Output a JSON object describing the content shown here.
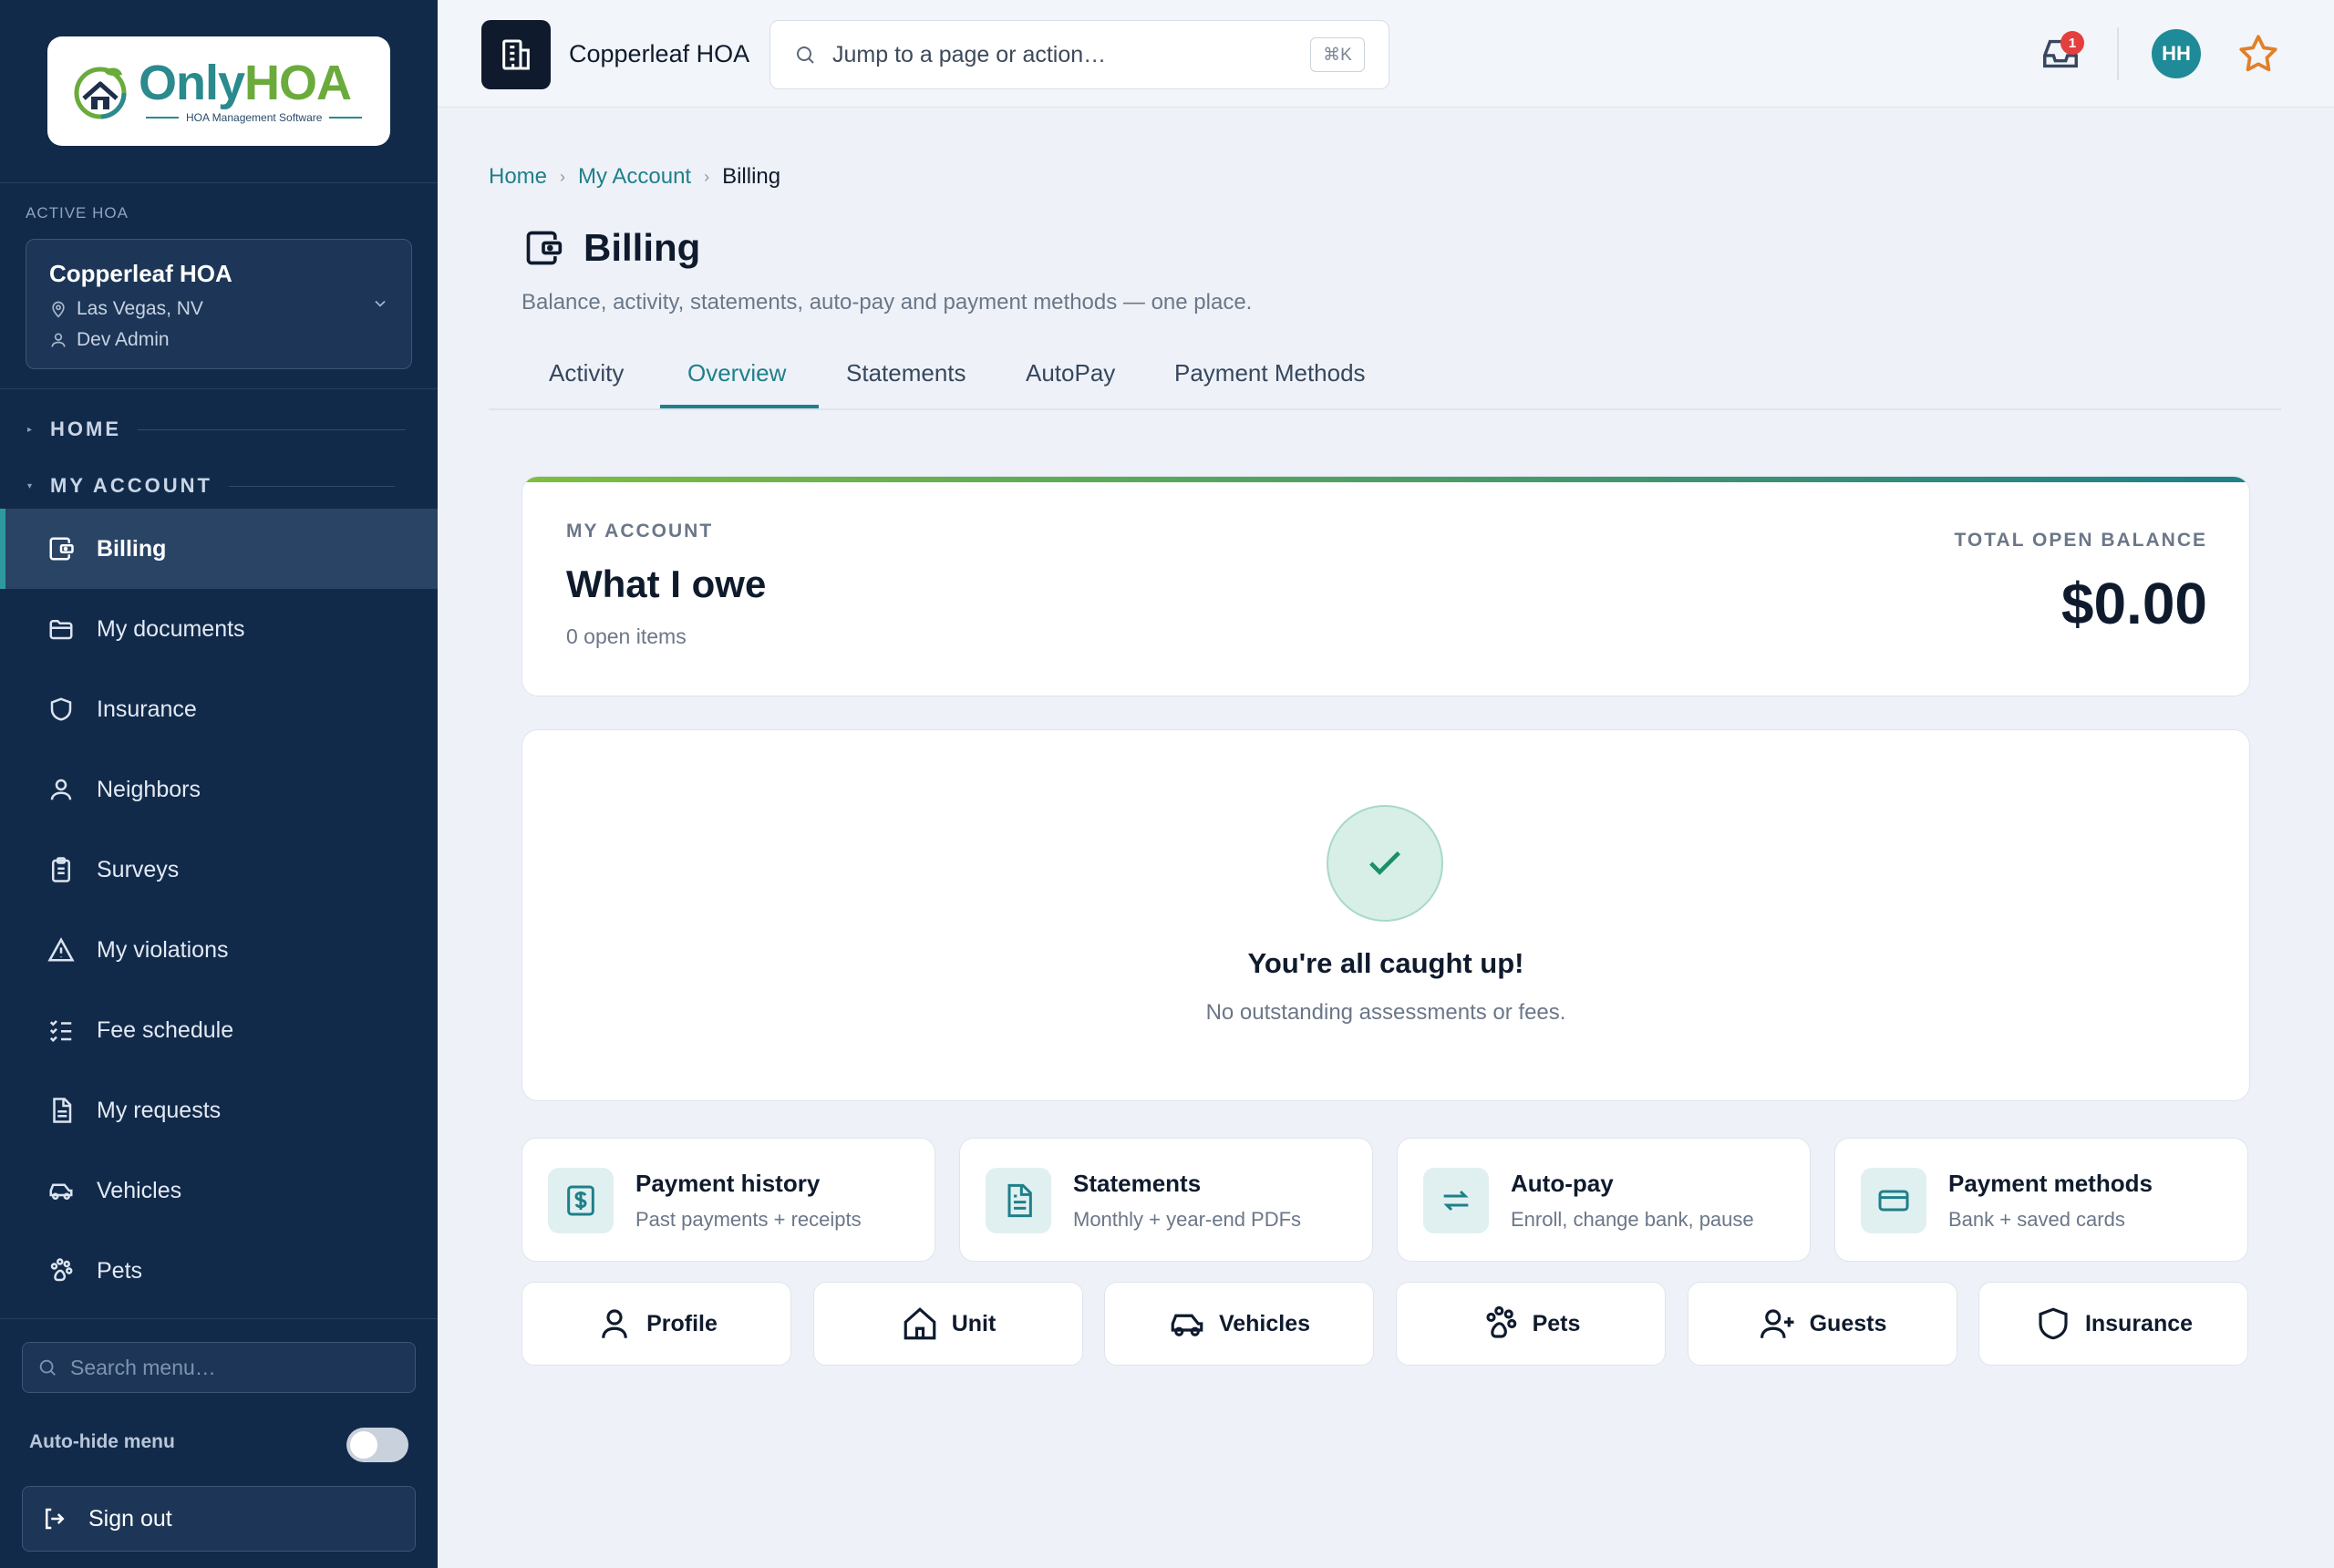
{
  "brand": {
    "logo_only": "Only",
    "logo_hoa": "HOA",
    "logo_tagline": "HOA Management Software"
  },
  "sidebar": {
    "active_hoa_label": "ACTIVE HOA",
    "hoa_name": "Copperleaf HOA",
    "hoa_location": "Las Vegas, NV",
    "hoa_user": "Dev Admin",
    "section_home": "HOME",
    "section_account": "MY ACCOUNT",
    "items": [
      {
        "label": "Billing",
        "icon": "wallet-icon",
        "active": true
      },
      {
        "label": "My documents",
        "icon": "folder-icon"
      },
      {
        "label": "Insurance",
        "icon": "shield-icon"
      },
      {
        "label": "Neighbors",
        "icon": "user-icon"
      },
      {
        "label": "Surveys",
        "icon": "clipboard-icon"
      },
      {
        "label": "My violations",
        "icon": "warning-icon"
      },
      {
        "label": "Fee schedule",
        "icon": "checklist-icon"
      },
      {
        "label": "My requests",
        "icon": "document-icon"
      },
      {
        "label": "Vehicles",
        "icon": "car-icon"
      },
      {
        "label": "Pets",
        "icon": "paw-icon"
      }
    ],
    "search_placeholder": "Search menu…",
    "autohide_label": "Auto-hide menu",
    "autohide_on": false,
    "signout_label": "Sign out"
  },
  "topbar": {
    "hoa_name": "Copperleaf HOA",
    "search_placeholder": "Jump to a page or action…",
    "search_shortcut": "⌘K",
    "inbox_count": "1",
    "avatar_initials": "HH"
  },
  "breadcrumb": [
    "Home",
    "My Account",
    "Billing"
  ],
  "page": {
    "title": "Billing",
    "subtitle": "Balance, activity, statements, auto-pay and payment methods — one place."
  },
  "tabs": [
    {
      "label": "Activity"
    },
    {
      "label": "Overview",
      "active": true
    },
    {
      "label": "Statements"
    },
    {
      "label": "AutoPay"
    },
    {
      "label": "Payment Methods"
    }
  ],
  "balance": {
    "eyebrow": "MY ACCOUNT",
    "title": "What I owe",
    "open_items": "0 open items",
    "total_label": "TOTAL OPEN BALANCE",
    "total_value": "$0.00"
  },
  "status": {
    "title": "You're all caught up!",
    "subtitle": "No outstanding assessments or fees."
  },
  "quick_links": [
    {
      "title": "Payment history",
      "subtitle": "Past payments + receipts",
      "icon": "receipt-icon"
    },
    {
      "title": "Statements",
      "subtitle": "Monthly + year-end PDFs",
      "icon": "document-icon"
    },
    {
      "title": "Auto-pay",
      "subtitle": "Enroll, change bank, pause",
      "icon": "repeat-icon"
    },
    {
      "title": "Payment methods",
      "subtitle": "Bank + saved cards",
      "icon": "credit-card-icon"
    }
  ],
  "shortcuts": [
    {
      "label": "Profile",
      "icon": "user-icon"
    },
    {
      "label": "Unit",
      "icon": "home-icon"
    },
    {
      "label": "Vehicles",
      "icon": "car-icon"
    },
    {
      "label": "Pets",
      "icon": "paw-icon"
    },
    {
      "label": "Guests",
      "icon": "user-plus-icon"
    },
    {
      "label": "Insurance",
      "icon": "shield-icon"
    }
  ],
  "colors": {
    "sidebar_bg": "#122a4a",
    "accent": "#1f7f8a",
    "brand_green": "#6aab3c",
    "badge_red": "#e53e3e",
    "star_orange": "#e0802a"
  }
}
